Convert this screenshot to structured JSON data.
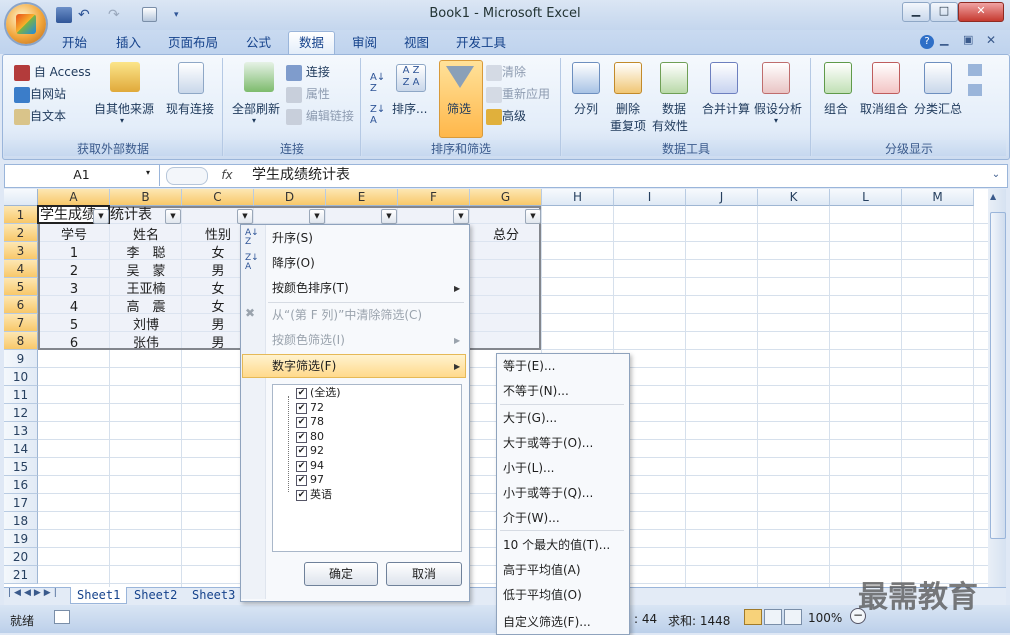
{
  "window": {
    "title": "Book1 - Microsoft Excel"
  },
  "tabs": [
    "开始",
    "插入",
    "页面布局",
    "公式",
    "数据",
    "审阅",
    "视图",
    "开发工具"
  ],
  "ribbon": {
    "get_external": {
      "access": "自 Access",
      "web": "自网站",
      "text": "自文本",
      "other": "自其他来源",
      "existing": "现有连接",
      "label": "获取外部数据"
    },
    "connections": {
      "refresh": "全部刷新",
      "conn": "连接",
      "props": "属性",
      "edit": "编辑链接",
      "label": "连接"
    },
    "sort_filter": {
      "sort": "排序...",
      "filter": "筛选",
      "clear": "清除",
      "reapply": "重新应用",
      "advanced": "高级",
      "label": "排序和筛选"
    },
    "data_tools": {
      "split": "分列",
      "dup1": "删除",
      "dup2": "重复项",
      "valid1": "数据",
      "valid2": "有效性",
      "consolidate": "合并计算",
      "whatif": "假设分析",
      "label": "数据工具"
    },
    "outline": {
      "group": "组合",
      "ungroup": "取消组合",
      "subtotal": "分类汇总",
      "label": "分级显示"
    }
  },
  "formula_bar": {
    "name": "A1",
    "fx": "fx",
    "value": "学生成绩统计表"
  },
  "columns": [
    "A",
    "B",
    "C",
    "D",
    "E",
    "F",
    "G",
    "H",
    "I",
    "J",
    "K",
    "L",
    "M"
  ],
  "rows": [
    "1",
    "2",
    "3",
    "4",
    "5",
    "6",
    "7",
    "8",
    "9",
    "10",
    "11",
    "12",
    "13",
    "14",
    "15",
    "16",
    "17",
    "18",
    "19",
    "20",
    "21"
  ],
  "sheet": {
    "title_part1": "学生成绩",
    "title_part2": "统计表",
    "headers": [
      "学号",
      "姓名",
      "性别"
    ],
    "total_header": "总分",
    "data": [
      [
        "1",
        "李　聪",
        "女"
      ],
      [
        "2",
        "吴　蒙",
        "男"
      ],
      [
        "3",
        "王亚楠",
        "女"
      ],
      [
        "4",
        "高　震",
        "女"
      ],
      [
        "5",
        "刘博",
        "男"
      ],
      [
        "6",
        "张伟",
        "男"
      ]
    ]
  },
  "filter_menu": {
    "sort_asc": "升序(S)",
    "sort_desc": "降序(O)",
    "sort_color": "按颜色排序(T)",
    "clear": "从“(第 F 列)”中清除筛选(C)",
    "filter_color": "按颜色筛选(I)",
    "number_filter": "数字筛选(F)",
    "list": [
      "(全选)",
      "72",
      "78",
      "80",
      "92",
      "94",
      "97",
      "英语"
    ],
    "ok": "确定",
    "cancel": "取消"
  },
  "number_submenu": [
    "等于(E)...",
    "不等于(N)...",
    "大于(G)...",
    "大于或等于(O)...",
    "小于(L)...",
    "小于或等于(Q)...",
    "介于(W)...",
    "10 个最大的值(T)...",
    "高于平均值(A)",
    "低于平均值(O)",
    "自定义筛选(F)..."
  ],
  "sheet_tabs": [
    "Sheet1",
    "Sheet2",
    "Sheet3"
  ],
  "status": {
    "ready": "就绪",
    "count": ": 44",
    "sum": "求和: 1448",
    "zoom": "100%"
  },
  "watermark": "最需教育"
}
